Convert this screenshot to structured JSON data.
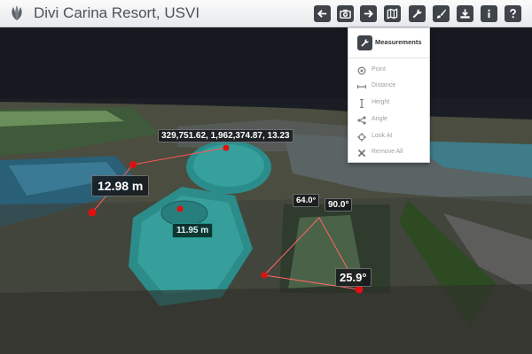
{
  "app": {
    "title": "Divi Carina Resort, USVI"
  },
  "toolbar": {
    "buttons": [
      {
        "icon": "back-arrow-icon"
      },
      {
        "icon": "camera-icon"
      },
      {
        "icon": "forward-arrow-icon"
      },
      {
        "icon": "map-icon"
      },
      {
        "icon": "wrench-icon"
      },
      {
        "icon": "brush-icon"
      },
      {
        "icon": "download-icon"
      },
      {
        "icon": "info-icon"
      },
      {
        "icon": "help-icon"
      }
    ]
  },
  "measurements_menu": {
    "title": "Measurements",
    "items": [
      {
        "label": "Point",
        "icon": "point-icon"
      },
      {
        "label": "Distance",
        "icon": "distance-icon"
      },
      {
        "label": "Height",
        "icon": "height-icon"
      },
      {
        "label": "Angle",
        "icon": "angle-icon"
      },
      {
        "label": "Look At",
        "icon": "crosshair-icon"
      },
      {
        "label": "Remove All",
        "icon": "remove-icon"
      }
    ]
  },
  "viewer": {
    "point_coords": "329,751.62, 1,962,374.87, 13.23",
    "distance_main": "12.98 m",
    "distance_radius": "11.95 m",
    "angle_a": "64.0°",
    "angle_b": "90.0°",
    "angle_c": "25.9°"
  },
  "colors": {
    "toolbar_button": "#3f444a",
    "marker_red": "#e01010",
    "roof_teal": "#2c8c8a",
    "water_dark": "#171b22"
  }
}
